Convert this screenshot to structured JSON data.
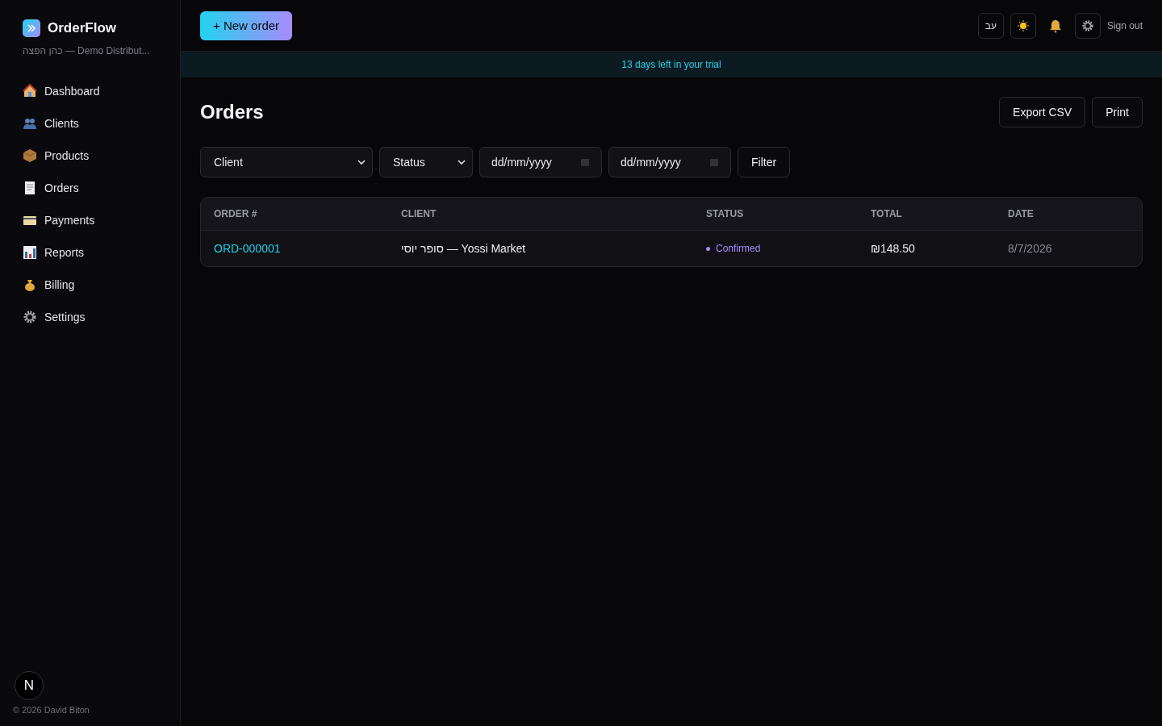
{
  "brand": {
    "name": "OrderFlow",
    "subtitle": "כהן הפצה — Demo Distribut..."
  },
  "sidebar": {
    "items": [
      {
        "label": "Dashboard",
        "selected": false
      },
      {
        "label": "Clients",
        "selected": false
      },
      {
        "label": "Products",
        "selected": false
      },
      {
        "label": "Orders",
        "selected": false
      },
      {
        "label": "Payments",
        "selected": false
      },
      {
        "label": "Reports",
        "selected": false
      },
      {
        "label": "Billing",
        "selected": false
      },
      {
        "label": "Settings",
        "selected": false
      }
    ],
    "badge": "N",
    "footer": "© 2026 David Biton"
  },
  "topbar": {
    "new_button": "+ New order",
    "language": "עב",
    "sign_out": "Sign out"
  },
  "trial_banner": "13 days left in your trial",
  "page": {
    "title": "Orders",
    "actions": [
      "Export CSV",
      "Print"
    ]
  },
  "filters": {
    "client": "Client",
    "status": "Status",
    "date_from": "dd/mm/yyyy",
    "date_to": "dd/mm/yyyy",
    "button": "Filter"
  },
  "table": {
    "columns": [
      "ORDER #",
      "CLIENT",
      "STATUS",
      "TOTAL",
      "DATE"
    ],
    "rows": [
      {
        "order": "ORD-000001",
        "client": "סופר יוסי — Yossi Market",
        "status": "Confirmed",
        "color": "#a78bfa",
        "total": "₪148.50",
        "date": "8/7/2026"
      }
    ]
  }
}
